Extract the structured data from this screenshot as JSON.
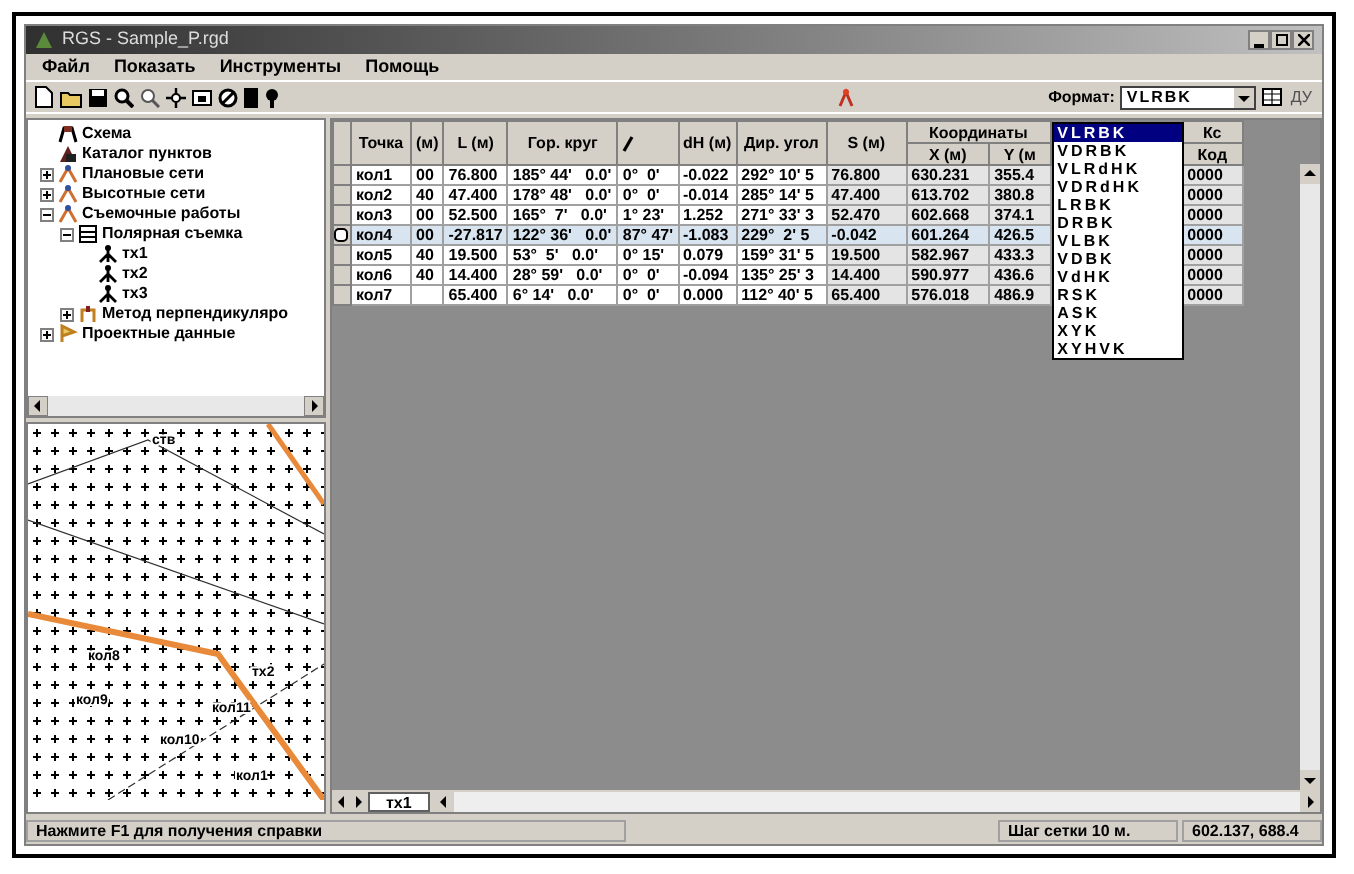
{
  "window": {
    "title": "RGS - Sample_P.rgd"
  },
  "menu": [
    "Файл",
    "Показать",
    "Инструменты",
    "Помощь"
  ],
  "toolbar": {
    "format_label": "Формат:",
    "format_value": "VLRBK",
    "right_button": "ДУ"
  },
  "tree": [
    {
      "label": "Схема",
      "kind": "scheme"
    },
    {
      "label": "Каталог пунктов",
      "kind": "catalog"
    },
    {
      "label": "Плановые сети",
      "kind": "network",
      "expanded": false
    },
    {
      "label": "Высотные сети",
      "kind": "network",
      "expanded": false
    },
    {
      "label": "Съемочные работы",
      "kind": "network",
      "expanded": true,
      "children": [
        {
          "label": "Полярная съемка",
          "kind": "list",
          "expanded": true,
          "children": [
            {
              "label": "тх1",
              "kind": "station"
            },
            {
              "label": "тх2",
              "kind": "station"
            },
            {
              "label": "тх3",
              "kind": "station"
            }
          ]
        },
        {
          "label": "Метод перпендикуляро",
          "kind": "method",
          "expanded": false
        }
      ]
    },
    {
      "label": "Проектные данные",
      "kind": "project",
      "expanded": false
    }
  ],
  "map": {
    "labels": [
      "ств",
      "кол8",
      "тх2",
      "кол9",
      "кол11",
      "кол10",
      "кол1"
    ]
  },
  "table": {
    "columns": [
      {
        "kind": "text",
        "label": "Точка"
      },
      {
        "kind": "text",
        "label": "(м)"
      },
      {
        "kind": "text",
        "label": "L (м)"
      },
      {
        "kind": "text",
        "label": "Гор. круг"
      },
      {
        "kind": "pencil"
      },
      {
        "kind": "text",
        "label": "dH (м)"
      },
      {
        "kind": "text",
        "label": "Дир. угол"
      },
      {
        "kind": "text",
        "label": "S (м)"
      },
      {
        "kind": "text",
        "label": "X (м)"
      },
      {
        "kind": "text",
        "label": "Y (м"
      },
      {
        "kind": "text",
        "label": "Код"
      }
    ],
    "group_header": "Координаты",
    "code_group_header": "Кс",
    "rows": [
      {
        "selected": false,
        "cells": [
          "кол1",
          "00",
          "76.800",
          "185° 44'   0.0'",
          "0°  0'",
          "-0.022",
          "292° 10' 5",
          "76.800",
          "630.231",
          "355.4",
          "0000"
        ]
      },
      {
        "selected": false,
        "cells": [
          "кол2",
          "40",
          "47.400",
          "178° 48'   0.0'",
          "0°  0'",
          "-0.014",
          "285° 14' 5",
          "47.400",
          "613.702",
          "380.8",
          "0000"
        ]
      },
      {
        "selected": false,
        "cells": [
          "кол3",
          "00",
          "52.500",
          "165°  7'   0.0'",
          "1° 23'",
          "1.252",
          "271° 33' 3",
          "52.470",
          "602.668",
          "374.1",
          "0000"
        ]
      },
      {
        "selected": true,
        "cells": [
          "кол4",
          "00",
          "-27.817",
          "122° 36'   0.0'",
          "87° 47'",
          "-1.083",
          "229°  2' 5",
          "-0.042",
          "601.264",
          "426.5",
          "0000"
        ]
      },
      {
        "selected": false,
        "cells": [
          "кол5",
          "40",
          "19.500",
          "53°  5'   0.0'",
          "0° 15'",
          "0.079",
          "159° 31' 5",
          "19.500",
          "582.967",
          "433.3",
          "0000"
        ]
      },
      {
        "selected": false,
        "cells": [
          "кол6",
          "40",
          "14.400",
          "28° 59'   0.0'",
          "0°  0'",
          "-0.094",
          "135° 25' 3",
          "14.400",
          "590.977",
          "436.6",
          "0000"
        ]
      },
      {
        "selected": false,
        "cells": [
          "кол7",
          "",
          "65.400",
          "6° 14'   0.0'",
          "0°  0'",
          "0.000",
          "112° 40' 5",
          "65.400",
          "576.018",
          "486.9",
          "0000"
        ]
      }
    ]
  },
  "format_dropdown": [
    {
      "label": "VLRBK",
      "selected": true
    },
    {
      "label": "VDRBK",
      "selected": false
    },
    {
      "label": "VLRdHK",
      "selected": false
    },
    {
      "label": "VDRdHK",
      "selected": false
    },
    {
      "label": "LRBK",
      "selected": false
    },
    {
      "label": "DRBK",
      "selected": false
    },
    {
      "label": "VLBK",
      "selected": false
    },
    {
      "label": "VDBK",
      "selected": false
    },
    {
      "label": "VdHK",
      "selected": false
    },
    {
      "label": "RSK",
      "selected": false
    },
    {
      "label": "ASK",
      "selected": false
    },
    {
      "label": "XYK",
      "selected": false
    },
    {
      "label": "XYHVK",
      "selected": false
    }
  ],
  "sheet_tabs": [
    {
      "label": "тх1",
      "selected": true
    }
  ],
  "status_bar": {
    "message": "Нажмите F1 для получения справки",
    "grid_step": "Шаг сетки 10 м.",
    "coordinates": "602.137, 688.4"
  }
}
